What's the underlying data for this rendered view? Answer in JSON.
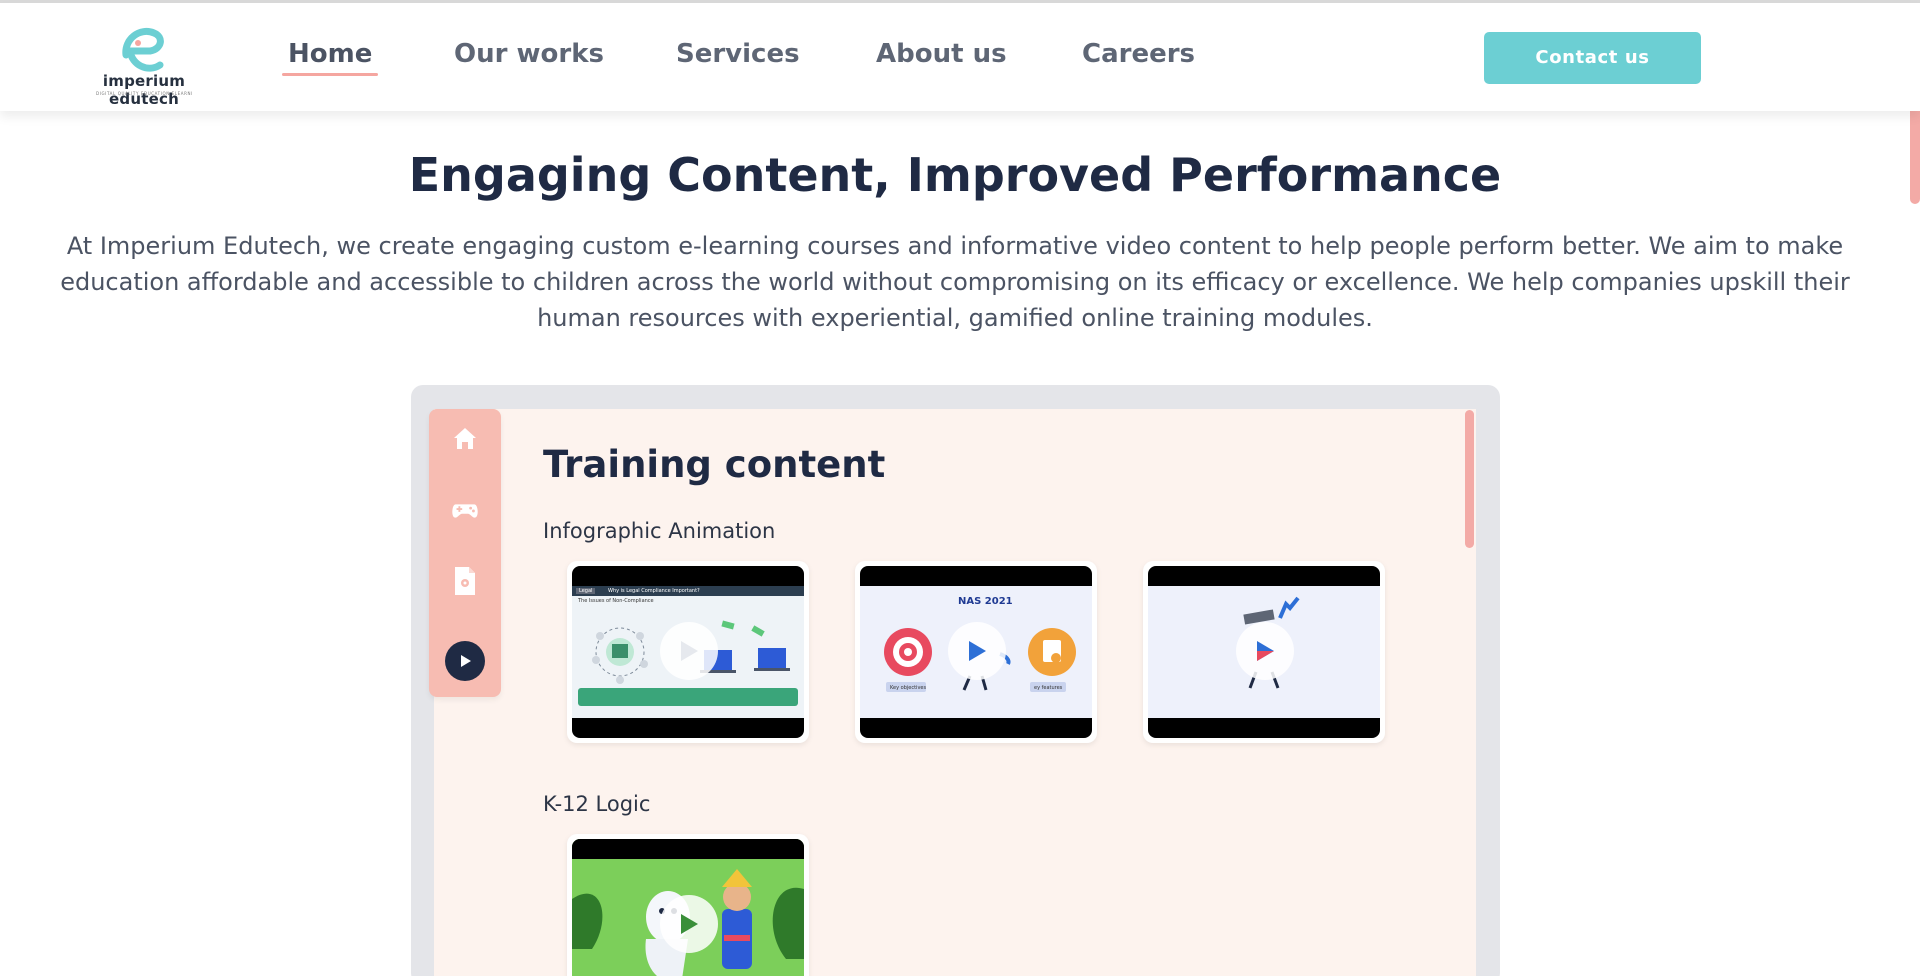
{
  "colors": {
    "accent_teal": "#6ccfd3",
    "accent_pink": "#f7bcb2",
    "heading_navy": "#1f2a44",
    "screen_bg": "#fdf3ee"
  },
  "brand": {
    "name": "imperium edutech",
    "tagline": "DIGITAL QUALITY EDUCATION ELEARNING",
    "logo_icon": "e-letter-logo-icon"
  },
  "nav": {
    "items": [
      {
        "label": "Home",
        "active": true
      },
      {
        "label": "Our works",
        "active": false
      },
      {
        "label": "Services",
        "active": false
      },
      {
        "label": "About us",
        "active": false
      },
      {
        "label": "Careers",
        "active": false
      }
    ],
    "contact_label": "Contact us"
  },
  "hero": {
    "title": "Engaging Content, Improved Performance",
    "description": "At Imperium Edutech, we create engaging custom e-learning courses and informative video content to help people perform better. We aim to make education affordable and accessible to children across the world without compromising on its efficacy or excellence. We help companies upskill their human resources with experiential, gamified online training modules."
  },
  "showcase": {
    "sidebar_icons": [
      "home-icon",
      "gamepad-icon",
      "document-icon",
      "play-icon"
    ],
    "title": "Training content",
    "categories": [
      {
        "label": "Infographic Animation",
        "videos": [
          {
            "thumb": "legal-compliance",
            "heading": "Why is Legal Compliance Important?",
            "subheading": "The Issues of Non-Compliance",
            "tag": "Legal"
          },
          {
            "thumb": "nas-2021",
            "heading": "NAS 2021",
            "left_label": "Key objectives",
            "right_label": "ey features"
          },
          {
            "thumb": "mascot"
          }
        ]
      },
      {
        "label": "K-12 Logic",
        "videos": [
          {
            "thumb": "forest-story"
          }
        ]
      }
    ]
  }
}
